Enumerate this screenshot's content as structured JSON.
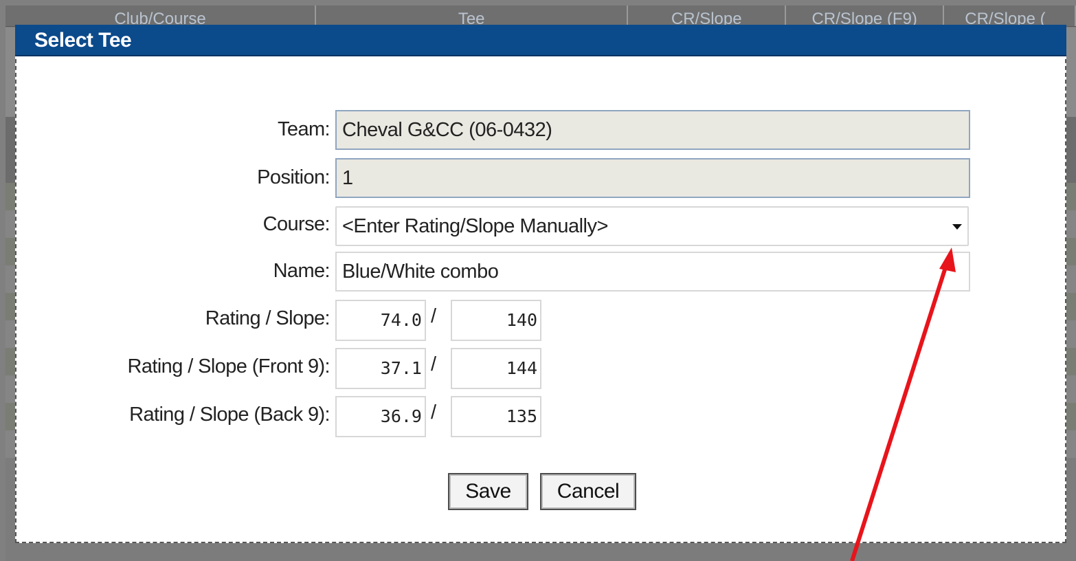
{
  "background": {
    "columns": [
      "Club/Course",
      "Tee",
      "CR/Slope",
      "CR/Slope (F9)",
      "CR/Slope ("
    ]
  },
  "dialog": {
    "title": "Select Tee",
    "team_label": "Team:",
    "team_value": "Cheval G&CC (06-0432)",
    "position_label": "Position:",
    "position_value": "1",
    "course_label": "Course:",
    "course_value": "<Enter Rating/Slope Manually>",
    "name_label": "Name:",
    "name_value": "Blue/White combo",
    "rating_label": "Rating / Slope:",
    "rating": "74.0",
    "slope": "140",
    "front_label": "Rating / Slope (Front 9):",
    "front_rating": "37.1",
    "front_slope": "144",
    "back_label": "Rating / Slope (Back 9):",
    "back_rating": "36.9",
    "back_slope": "135",
    "separator": "/",
    "save_label": "Save",
    "cancel_label": "Cancel"
  },
  "colors": {
    "titlebar": "#0b4a8b",
    "annotation_arrow": "#e8141b"
  },
  "icons": {
    "dropdown": "chevron-down-icon"
  }
}
